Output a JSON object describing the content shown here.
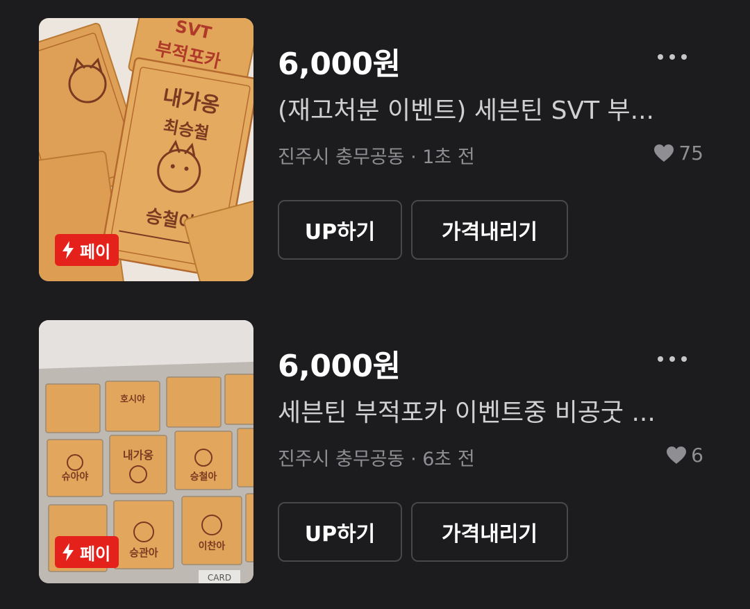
{
  "listings": [
    {
      "price": "6,000원",
      "title": "(재고처분 이벤트) 세븐틴 SVT 부...",
      "location": "진주시 충무공동",
      "separator": "·",
      "time": "1초 전",
      "likes": "75",
      "badge": "페이",
      "up_label": "UP하기",
      "price_down_label": "가격내리기",
      "thumb_texts": [
        "SVT",
        "부적포카",
        "내가옹",
        "최승철",
        "승철아"
      ]
    },
    {
      "price": "6,000원",
      "title": "세븐틴 부적포카 이벤트중 비공굿 ...",
      "location": "진주시 충무공동",
      "separator": "·",
      "time": "6초 전",
      "likes": "6",
      "badge": "페이",
      "up_label": "UP하기",
      "price_down_label": "가격내리기",
      "thumb_texts": [
        "내가옹",
        "호시야",
        "승철아",
        "슈아야",
        "승관아",
        "이찬아",
        "CARD"
      ]
    }
  ],
  "icons": {
    "more": "more-dots-icon",
    "heart": "heart-icon",
    "bolt": "lightning-bolt-icon"
  },
  "colors": {
    "background": "#1c1c1e",
    "badge": "#e5211b",
    "muted_text": "#8e8e93",
    "card_orange": "#e2a65a"
  }
}
